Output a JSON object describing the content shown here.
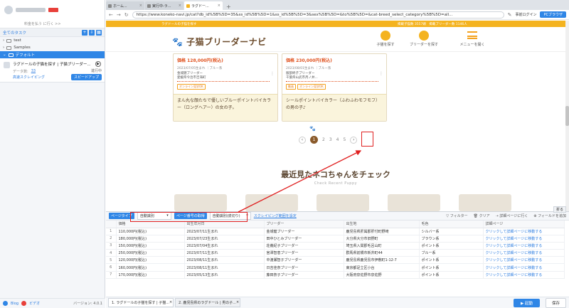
{
  "sidebar": {
    "pay_link": "料金を払う に行く >>",
    "all_tasks": "全てのタスク",
    "tree": [
      {
        "label": "test"
      },
      {
        "label": "Samples"
      },
      {
        "label": "デフォルト"
      }
    ],
    "task": {
      "title": "ラグドールの子猫を探す | 子猫ブリーダー...",
      "data_label": "データ数:",
      "data_value": "33",
      "status": "進行中",
      "mode": "高速スクレイピング",
      "speedup": "スピードアップ"
    },
    "footer": {
      "link1": "Blog",
      "link2": "ビデオ",
      "version": "バージョン: 4.0.1"
    }
  },
  "browser": {
    "tabs": [
      {
        "label": "ホーム..."
      },
      {
        "label": "実行中-ラ..."
      },
      {
        "label": "ラグドー..."
      }
    ],
    "url": "https://www.koneko-navi.jp/cat?db_id%5B%5D=35&ss_id%5B%5D=1&ss_id%5B%5D=3&sex%5B%5D=&to%5B%5D=&cat-breed_select_category%5B%5D=all...",
    "login": "事前ログイン",
    "pc_browser": "PCブラウザ"
  },
  "site": {
    "top_left": "ラグドールの子猫を探す",
    "top_right": "掲載子猫数 3557頭　掲載ブリーダー数 1146人",
    "logo": "子猫ブリーダーナビ",
    "buttons": [
      {
        "label": "子猫を探す"
      },
      {
        "label": "ブリーダーを探す"
      },
      {
        "label": "メニューを開く"
      }
    ],
    "cards": [
      {
        "price": "価格 128,000円(税込)",
        "dob": "2023/07/05生まれ ｜ブルー系",
        "breeder": "金城健ブリーダー",
        "loc": "愛媛県今治市吉海町",
        "tags": [
          "オンライン見学OK"
        ],
        "desc": "まん丸な顔たちで優しいブルーポイントバイカラー（ロングヘアー）の女の子。"
      },
      {
        "price": "価格 230,000円(税込)",
        "dob": "2023/08/01生まれ ｜ブルー系",
        "breeder": "服部終子ブリーダー",
        "loc": "千葉県山武市月ノ井...",
        "tags": [
          "動画",
          "オンライン見学OK"
        ],
        "desc": "シールポイントバイカラー（ふわふわモフモフ）の男の子♪"
      }
    ],
    "pager": {
      "prev": "‹",
      "pages": [
        "1",
        "2",
        "3",
        "4",
        "5"
      ],
      "next": "›"
    },
    "recent_title": "最近見たネコちゃんをチェック",
    "recent_sub": "Check Recent Puppy"
  },
  "panel": {
    "fold": "折る",
    "page_type_label": "ページタイプ",
    "page_type_value": "自動識別",
    "page_no_label": "ページ番号の取得",
    "page_no_value": "自動識別(皮切り)",
    "scrape_range": "スクレイピング範囲を設定",
    "tools": [
      "フィルター",
      "クリア",
      "詳細ページに行く",
      "フィールドを追加"
    ],
    "columns": [
      "価格",
      "出生年月日",
      "ブリーダー",
      "出生地",
      "毛色",
      "詳細ページ"
    ],
    "rows": [
      [
        "110,000円(税込)",
        "2023/07/11生まれ",
        "金城健ブリーダー",
        "鹿児島県肝属郡肝付町野崎",
        "シルバー系",
        "クリックして詳細ページに移動する"
      ],
      [
        "180,000円(税込)",
        "2023/07/23生まれ",
        "田中ひとみブリーダー",
        "大分県大分市旧野町",
        "ブラウン系",
        "クリックして詳細ページに移動する"
      ],
      [
        "150,000円(税込)",
        "2023/07/04生まれ",
        "荘義紀子ブリーダー",
        "埼玉県入間郡毛呂山町",
        "ポイント系",
        "クリックして詳細ページに移動する"
      ],
      [
        "250,000円(税込)",
        "2023/07/11生まれ",
        "宮澤智恵ブリーダー",
        "群馬県前橋市新井町44",
        "ブルー系",
        "クリックして詳細ページに移動する"
      ],
      [
        "120,000円(税込)",
        "2023/08/11生まれ",
        "中渡瀬智子ブリーダー",
        "鹿児島県鹿児島市伊敷町1-12-7",
        "ポイント系",
        "クリックして詳細ページに移動する"
      ],
      [
        "160,000円(税込)",
        "2023/08/11生まれ",
        "日吉佳奈ブリーダー",
        "東京都足立区小台",
        "ポイント系",
        "クリックして詳細ページに移動する"
      ],
      [
        "170,000円(税込)",
        "2023/05/13生まれ",
        "藤田奈子ブリーダー",
        "大阪府泉佐野市泉佐野",
        "ポイント系",
        "クリックして詳細ページに移動する"
      ]
    ],
    "bottom_tabs": [
      {
        "label": "1. ラグドールの子猫を探す | 子猫..."
      },
      {
        "label": "2. 鹿児島県のラグドール | 男の子..."
      }
    ],
    "start": "▶ 起動",
    "save": "保存"
  },
  "colors": {
    "accent": "#2f86e6",
    "site_gold": "#f4b31f",
    "price": "#e05320",
    "annotation": "#e02020"
  }
}
